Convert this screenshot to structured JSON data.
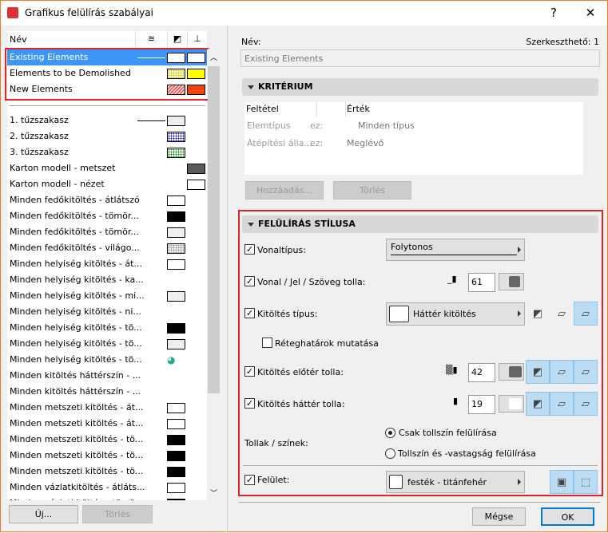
{
  "window": {
    "title": "Grafikus felülírás szabályai",
    "help": "?",
    "close": "✕"
  },
  "list_header": {
    "name": "Név",
    "col_line_icon": "line-type-icon",
    "col_fill_icon": "fill-icon",
    "col_brush_icon": "surface-brush-icon"
  },
  "top_rules": [
    {
      "label": "Existing Elements",
      "line": true,
      "c1": "#ffffff",
      "c2": "#ffffff",
      "selected": true
    },
    {
      "label": "Elements to be Demolished",
      "c1": "dots-yellow",
      "c2": "#ffff00"
    },
    {
      "label": "New Elements",
      "c1": "hatch-red",
      "c2": "#ee4411"
    }
  ],
  "rules": [
    {
      "label": "1. tűzszakasz",
      "line": true,
      "c1": "#eeeeee"
    },
    {
      "label": "2. tűzszakasz",
      "c1": "dots-blue"
    },
    {
      "label": "3. tűzszakasz",
      "c1": "dots-green"
    },
    {
      "label": "Karton modell - metszet",
      "c2": "#5a5a5a"
    },
    {
      "label": "Karton modell - nézet",
      "c2": "#ffffff"
    },
    {
      "label": "Minden fedőkitöltés - átlátszó",
      "c1": "#ffffff"
    },
    {
      "label": "Minden fedőkitöltés - tömör...",
      "c1": "#000000"
    },
    {
      "label": "Minden fedőkitöltés - tömör...",
      "c1": "#eeeeee"
    },
    {
      "label": "Minden fedőkitöltés - világo...",
      "c1": "dots-gray"
    },
    {
      "label": "Minden helyiség kitöltés - át...",
      "c1": "#ffffff"
    },
    {
      "label": "Minden helyiség kitöltés - ka..."
    },
    {
      "label": "Minden helyiség kitöltés - mi...",
      "c1": "#eeeeee"
    },
    {
      "label": "Minden helyiség kitöltés - ni..."
    },
    {
      "label": "Minden helyiség kitöltés - tö...",
      "c1": "#000000"
    },
    {
      "label": "Minden helyiség kitöltés - tö...",
      "c1": "#eeeeee"
    },
    {
      "label": "Minden helyiség kitöltés - tö...",
      "c1": "icon"
    },
    {
      "label": "Minden kitöltés háttérszín - ..."
    },
    {
      "label": "Minden kitöltés háttérszín - ..."
    },
    {
      "label": "Minden metszeti kitöltés - át...",
      "c1": "#ffffff"
    },
    {
      "label": "Minden metszeti kitöltés - át...",
      "c1": "#ffffff"
    },
    {
      "label": "Minden metszeti kitöltés - tö...",
      "c1": "#000000"
    },
    {
      "label": "Minden metszeti kitöltés - tö...",
      "c1": "#000000"
    },
    {
      "label": "Minden metszeti kitöltés - tö...",
      "c1": "#000000"
    },
    {
      "label": "Minden vázlatkitöltés - átláts...",
      "c1": "#ffffff"
    },
    {
      "label": "Minden vázlatkitöltés - tömör...",
      "c1": "#000000"
    }
  ],
  "left_buttons": {
    "new": "Új...",
    "delete": "Törlés"
  },
  "right": {
    "name_label": "Név:",
    "editable": "Szerkeszthető: 1",
    "name_value": "Existing Elements",
    "criteria": {
      "title": "KRITÉRIUM",
      "col_condition": "Feltétel",
      "col_value": "Érték",
      "rows": [
        {
          "cond": "Elemtípus",
          "op": "ez:",
          "value": "Minden típus"
        },
        {
          "cond": "Átépítési álla...",
          "op": "ez:",
          "value": "Meglévő"
        }
      ],
      "add": "Hozzáadás...",
      "delete": "Törlés"
    },
    "style": {
      "title": "FELÜLÍRÁS STÍLUSA",
      "linetype_label": "Vonaltípus:",
      "linetype_value": "Folytonos",
      "pen_label": "Vonal / Jel / Szöveg tolla:",
      "pen_value": "61",
      "filltype_label": "Kitöltés típus:",
      "filltype_value": "Háttér kitöltés",
      "layer_bounds_label": "Réteghatárok mutatása",
      "fg_label": "Kitöltés előtér tolla:",
      "fg_value": "42",
      "bg_label": "Kitöltés háttér tolla:",
      "bg_value": "19",
      "pens_label": "Tollak / színek:",
      "radio1": "Csak tollszín felülírása",
      "radio2": "Tollszín és -vastagság felülírása",
      "surface_label": "Felület:",
      "surface_value": "festék - titánfehér"
    },
    "cancel": "Mégse",
    "ok": "OK"
  },
  "colors": {
    "selection": "#3d96f5",
    "highlight_box": "#e0232a",
    "toggle_on": "#bcdcf4"
  }
}
